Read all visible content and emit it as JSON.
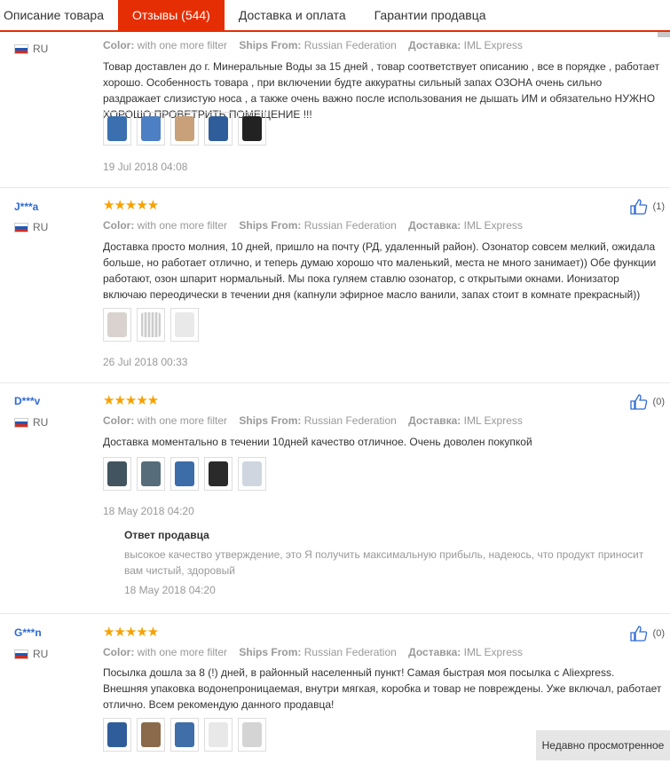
{
  "tabs": [
    {
      "label": "Описание товара"
    },
    {
      "label": "Отзывы (544)"
    },
    {
      "label": "Доставка и оплата"
    },
    {
      "label": "Гарантии продавца"
    }
  ],
  "labels": {
    "color": "Color:",
    "ships_from": "Ships From:",
    "delivery": "Доставка:",
    "seller_reply_title": "Ответ продавца"
  },
  "reviews": [
    {
      "user": "",
      "country": "RU",
      "stars": "",
      "color": "with one more filter",
      "ships_from": "Russian Federation",
      "delivery": "IML Express",
      "text": "Товар доставлен до г. Минеральные Воды за 15 дней , товар соответствует описанию , все в порядке , работает хорошо. Особенность товара , при включении будте аккуратны сильный запах ОЗОНА очень сильно раздражает слизистую носа , а также очень важно после использования не дышать ИМ и обязательно НУЖНО ХОРОШО ПРОВЕТРИТЬ ПОМЕЩЕНИЕ !!!",
      "photos": 5,
      "date": "19 Jul 2018 04:08"
    },
    {
      "user": "J***a",
      "country": "RU",
      "stars": "★★★★★",
      "color": "with one more filter",
      "ships_from": "Russian Federation",
      "delivery": "IML Express",
      "text": "Доставка просто молния, 10 дней, пришло на почту (РД, удаленный район). Озонатор совсем мелкий, ожидала больше, но работает отлично, и теперь думаю хорошо что маленький, места не много занимает)) Обе функции работают, озон шпарит нормальный. Мы пока гуляем ставлю озонатор, с открытыми окнами. Ионизатор включаю переодически в течении дня (капнули эфирное масло ванили, запах стоит в комнате прекрасный))",
      "photos": 3,
      "date": "26 Jul 2018 00:33",
      "helpful": "(1)"
    },
    {
      "user": "D***v",
      "country": "RU",
      "stars": "★★★★★",
      "color": "with one more filter",
      "ships_from": "Russian Federation",
      "delivery": "IML Express",
      "text": "Доставка моментально в течении 10дней качество отличное. Очень доволен покупкой",
      "photos": 5,
      "date": "18 May 2018 04:20",
      "helpful": "(0)",
      "seller_reply": {
        "text": "высокое качество утверждение, это Я получить максимальную прибыль, надеюсь, что продукт приносит вам чистый, здоровый",
        "date": "18 May 2018 04:20"
      }
    },
    {
      "user": "G***n",
      "country": "RU",
      "stars": "★★★★★",
      "color": "with one more filter",
      "ships_from": "Russian Federation",
      "delivery": "IML Express",
      "text": "Посылка дошла за 8 (!) дней, в районный населенный пункт! Самая быстрая моя посылка с Aliexpress. Внешняя упаковка водонепроницаемая, внутри мягкая, коробка и товар не повреждены. Уже включал, работает отлично. Всем рекомендую данного продавца!",
      "photos": 5,
      "helpful": "(0)"
    }
  ],
  "recent_button": "Недавно просмотренное",
  "colors": {
    "accent": "#e62e04",
    "star": "#f7a100",
    "user": "#2f6ad4"
  }
}
